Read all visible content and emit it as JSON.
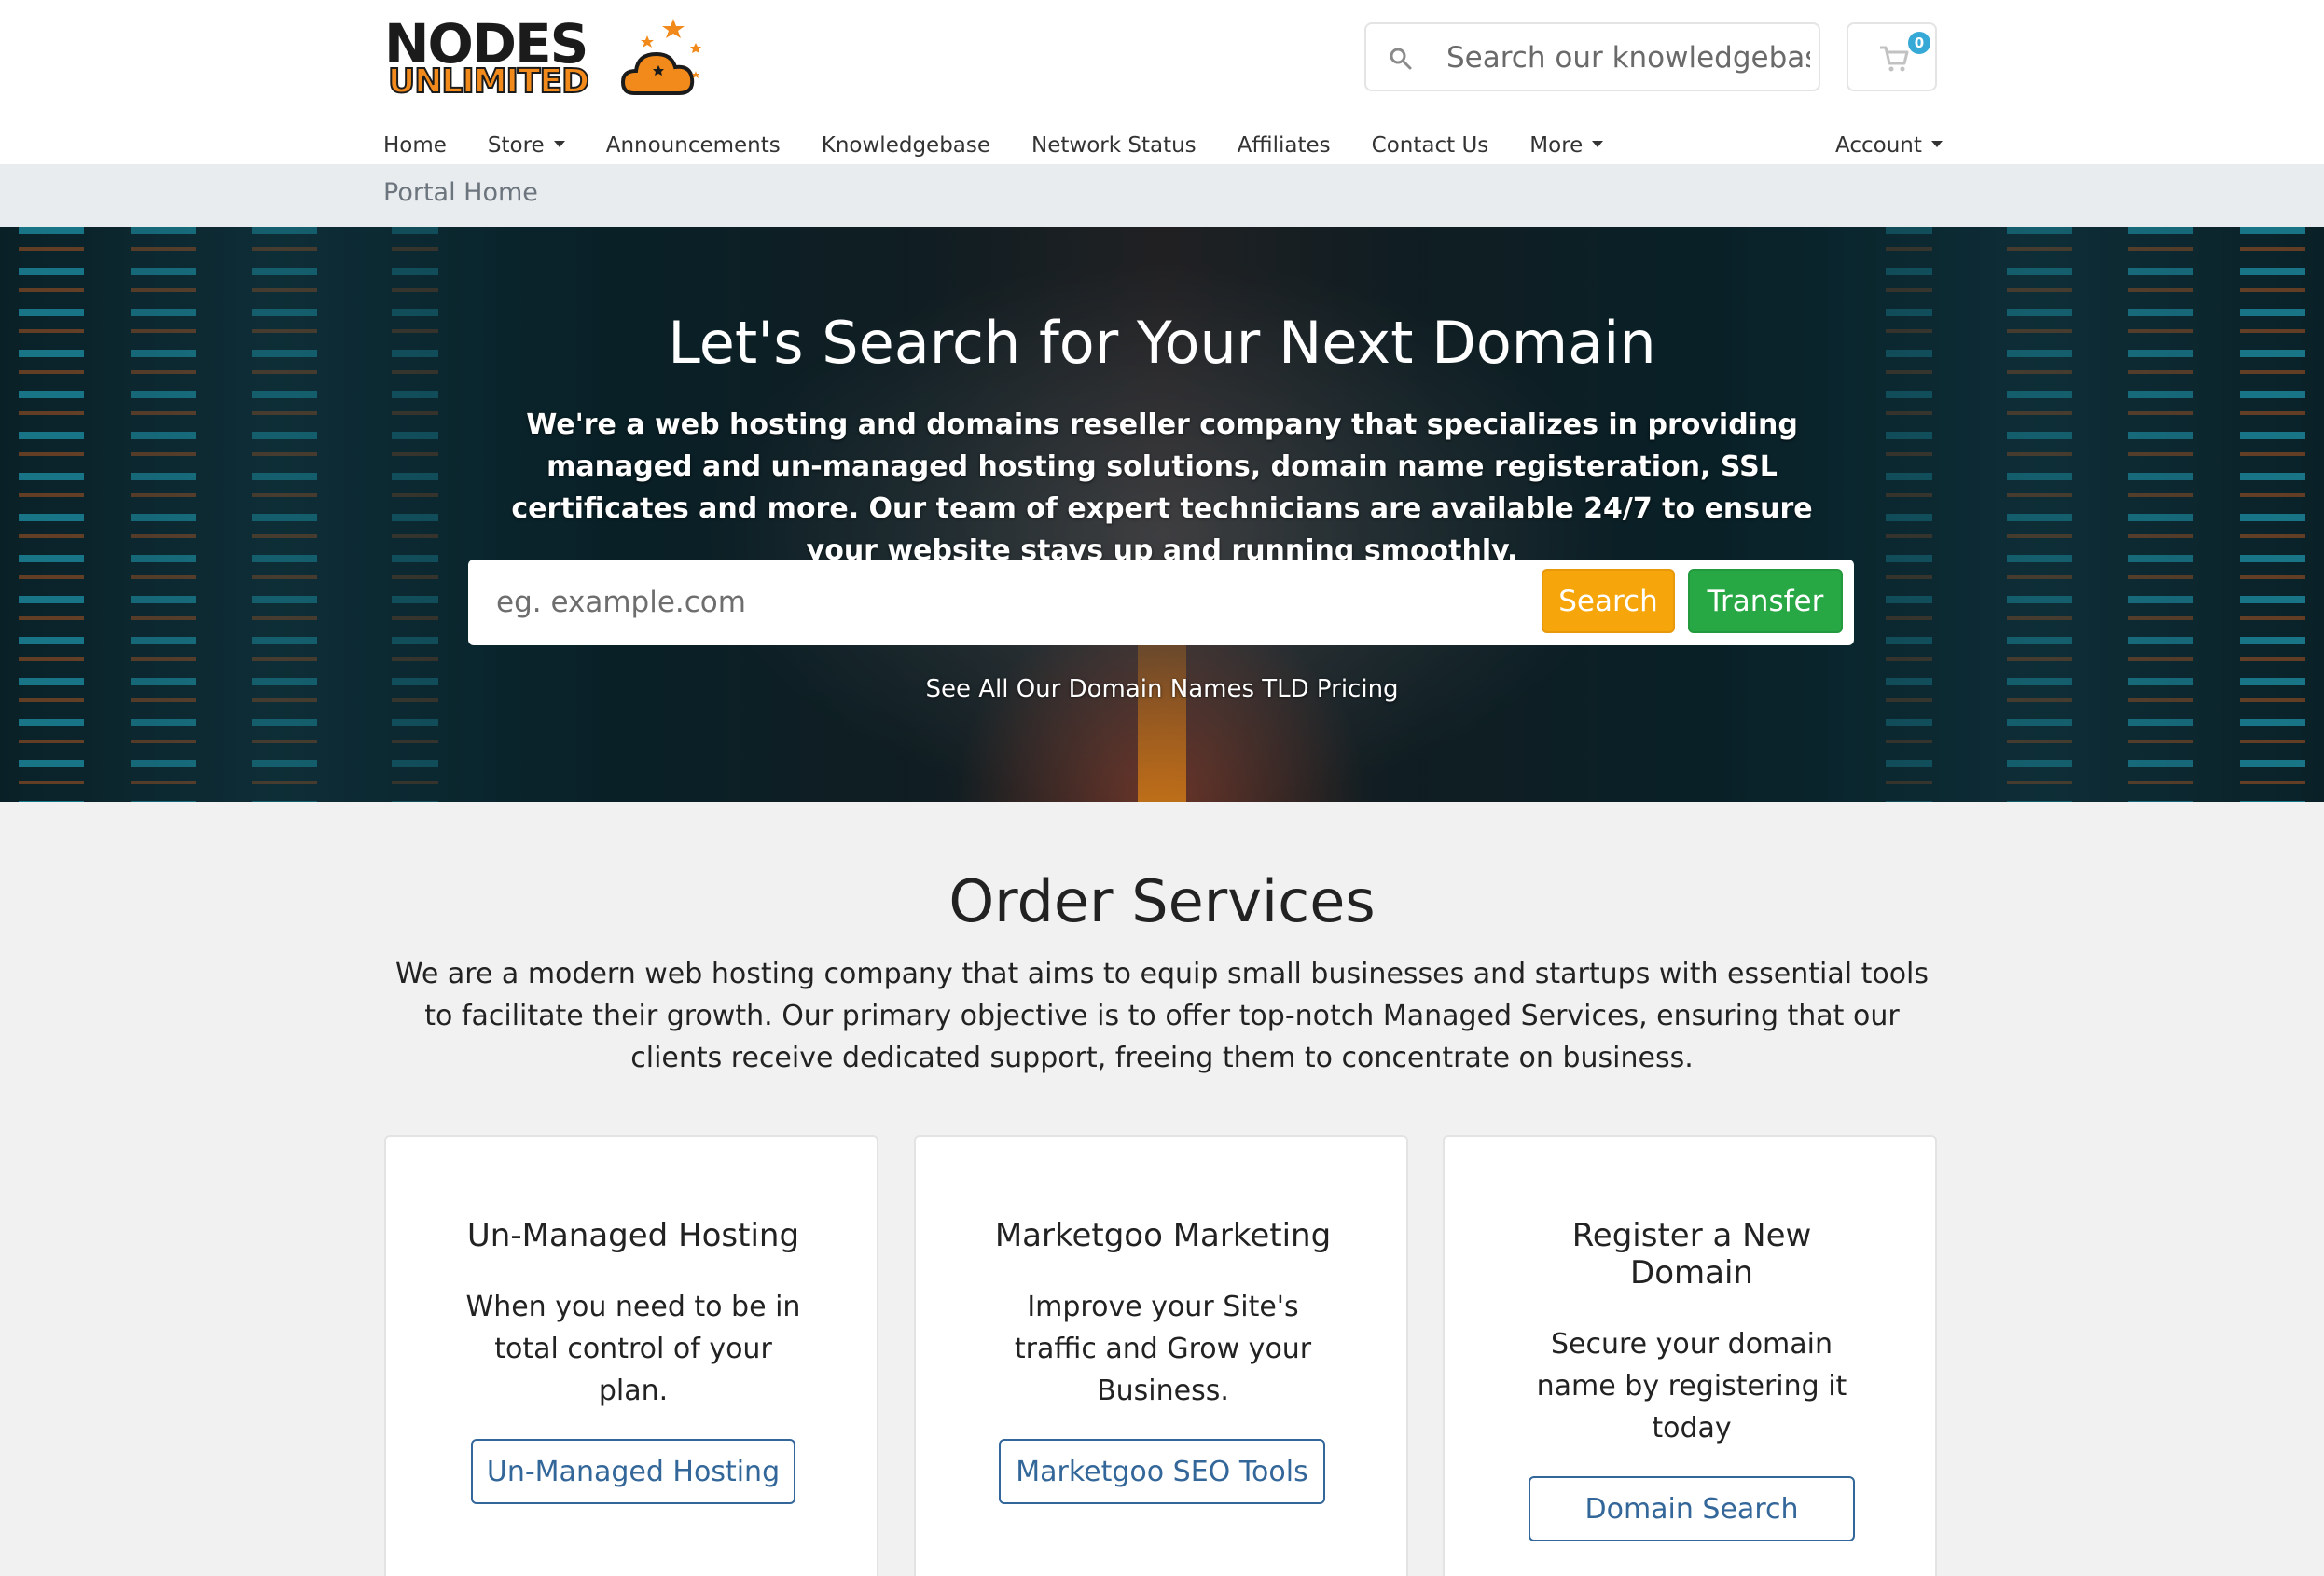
{
  "header": {
    "logo": {
      "line1": "NODES",
      "line2": "UNLIMITED"
    },
    "kb_search": {
      "placeholder": "Search our knowledgebase..."
    },
    "cart": {
      "count": "0"
    }
  },
  "nav": {
    "items": [
      {
        "label": "Home"
      },
      {
        "label": "Store"
      },
      {
        "label": "Announcements"
      },
      {
        "label": "Knowledgebase"
      },
      {
        "label": "Network Status"
      },
      {
        "label": "Affiliates"
      },
      {
        "label": "Contact Us"
      },
      {
        "label": "More"
      }
    ],
    "account_label": "Account"
  },
  "breadcrumb": {
    "label": "Portal Home"
  },
  "hero": {
    "title": "Let's Search for Your Next Domain",
    "text": "We're a web hosting and domains reseller company that specializes in providing managed and un-managed hosting solutions, domain name registeration, SSL certificates and more. Our team of expert technicians are available 24/7 to ensure your website stays up and running smoothly.",
    "domain_placeholder": "eg. example.com",
    "search_label": "Search",
    "transfer_label": "Transfer",
    "tld_link": "See All Our Domain Names TLD Pricing"
  },
  "order_services": {
    "title": "Order Services",
    "text": "We are a modern web hosting company that aims to equip small businesses and startups with essential tools to facilitate their growth. Our primary objective is to offer top-notch Managed Services, ensuring that our clients receive dedicated support, freeing them to concentrate on business.",
    "cards": [
      {
        "title": "Un-Managed Hosting",
        "description": "When you need to be in total control of your plan.",
        "button": "Un-Managed Hosting"
      },
      {
        "title": "Marketgoo Marketing",
        "description": "Improve your Site's traffic and Grow your Business.",
        "button": "Marketgoo SEO Tools"
      },
      {
        "title": "Register a New Domain",
        "description": "Secure your domain name by registering it today",
        "button": "Domain Search"
      }
    ]
  },
  "colors": {
    "accent_orange": "#f6a50a",
    "accent_green": "#28a745",
    "link_blue": "#336699",
    "cart_badge": "#36a9d6"
  },
  "icons": {
    "kb_search": "search-icon",
    "cart": "cart-icon",
    "logo": "cloud-stars-logo-icon"
  }
}
